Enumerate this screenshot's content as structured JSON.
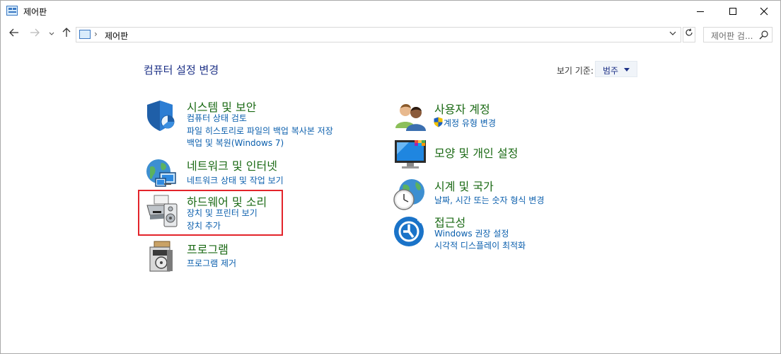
{
  "window": {
    "title": "제어판"
  },
  "address": {
    "path": "제어판",
    "search_placeholder": "제어판 검..."
  },
  "content": {
    "title": "컴퓨터 설정 변경",
    "view_by_label": "보기 기준:",
    "view_by_value": "범주"
  },
  "categories": {
    "system": {
      "title": "시스템 및 보안",
      "links": [
        "컴퓨터 상태 검토",
        "파일 히스토리로 파일의 백업 복사본 저장",
        "백업 및 복원(Windows 7)"
      ]
    },
    "network": {
      "title": "네트워크 및 인터넷",
      "links": [
        "네트워크 상태 및 작업 보기"
      ]
    },
    "hardware": {
      "title": "하드웨어 및 소리",
      "links": [
        "장치 및 프린터 보기",
        "장치 추가"
      ]
    },
    "programs": {
      "title": "프로그램",
      "links": [
        "프로그램 제거"
      ]
    },
    "users": {
      "title": "사용자 계정",
      "links": [
        "계정 유형 변경"
      ]
    },
    "appearance": {
      "title": "모양 및 개인 설정",
      "links": []
    },
    "clock": {
      "title": "시계 및 국가",
      "links": [
        "날짜, 시간 또는 숫자 형식 변경"
      ]
    },
    "access": {
      "title": "접근성",
      "links": [
        "Windows 권장 설정",
        "시각적 디스플레이 최적화"
      ]
    }
  },
  "icons": {
    "system": "shield-icon",
    "network": "network-globe-icon",
    "hardware": "printer-speaker-icon",
    "programs": "program-box-icon",
    "users": "users-icon",
    "appearance": "monitor-color-icon",
    "clock": "clock-globe-icon",
    "access": "accessibility-icon",
    "uac": "uac-shield-icon"
  },
  "colors": {
    "heading": "#1b6a15",
    "link": "#0b5fad",
    "title": "#1e3287",
    "highlight": "#e3242b"
  }
}
